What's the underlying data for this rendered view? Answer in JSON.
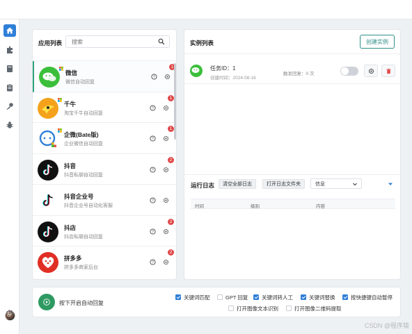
{
  "apps_panel": {
    "title": "应用列表",
    "search_placeholder": "搜索",
    "apps": [
      {
        "name": "微信",
        "desc": "微信自动回复",
        "badge": "1",
        "icon": "wechat-icon",
        "color": "#3bbf3b"
      },
      {
        "name": "千牛",
        "desc": "淘宝千牛自动回复",
        "badge": "1",
        "icon": "qianniu-icon",
        "color": "#f4a21c"
      },
      {
        "name": "企微(Bate版)",
        "desc": "企业微信自动回复",
        "badge": "1",
        "icon": "wecom-icon",
        "color": "#2f7fd8"
      },
      {
        "name": "抖音",
        "desc": "抖音私聊自动回复",
        "badge": "2",
        "icon": "douyin-icon",
        "color": "#111111"
      },
      {
        "name": "抖音企业号",
        "desc": "抖音企业号自动化客服",
        "badge": "",
        "icon": "douyin-icon",
        "color": "#111111"
      },
      {
        "name": "抖店",
        "desc": "抖店私聊自动回复",
        "badge": "2",
        "icon": "douyin-icon",
        "color": "#111111"
      },
      {
        "name": "拼多多",
        "desc": "拼多多商家后台",
        "badge": "2",
        "icon": "pinduoduo-icon",
        "color": "#e02e24"
      }
    ]
  },
  "instance_panel": {
    "title": "实例列表",
    "create_label": "创建实例",
    "instance": {
      "id_label": "任务ID：",
      "id_value": "1",
      "created_label": "创建时间：",
      "created_value": "2024-08-16",
      "trigger_label": "触发回复：",
      "trigger_value": "0 次",
      "enabled": false
    },
    "log": {
      "title": "运行日志",
      "clear_label": "清空全部日志",
      "open_folder_label": "打开日志文件夹",
      "level_value": "信息",
      "columns": [
        "时间",
        "级别",
        "内容"
      ]
    }
  },
  "bottom_bar": {
    "start_label": "按下开启自动回复",
    "options": [
      {
        "label": "关键词匹配",
        "checked": true
      },
      {
        "label": "GPT 回复",
        "checked": false
      },
      {
        "label": "关键词转人工",
        "checked": true
      },
      {
        "label": "关键词替换",
        "checked": true
      },
      {
        "label": "按快捷键自动暂停",
        "checked": true
      },
      {
        "label": "打开图像文本识别",
        "checked": false
      },
      {
        "label": "打开图像二维码提取",
        "checked": false
      }
    ]
  },
  "watermark": "CSDN @程序猿",
  "colors": {
    "accent": "#2f7fd8",
    "primary_green": "#2e9a62",
    "badge_red": "#e04848",
    "teal": "#2f8f87"
  }
}
